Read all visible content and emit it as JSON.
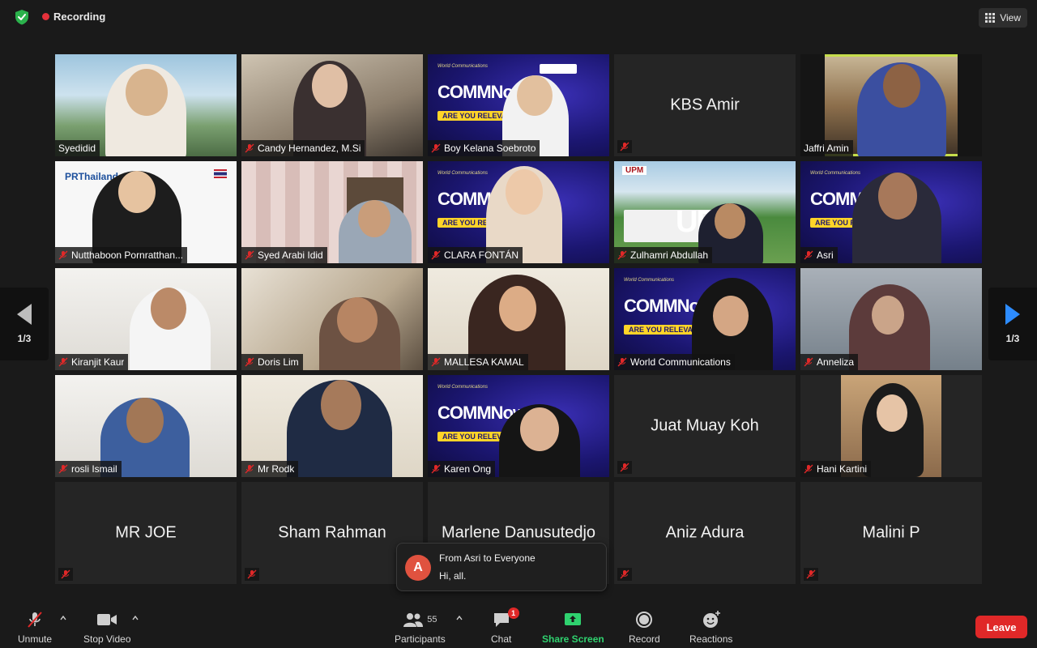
{
  "topbar": {
    "recording_label": "Recording",
    "view_label": "View"
  },
  "participants": [
    {
      "name": "Syedidid",
      "muted": false,
      "type": "video"
    },
    {
      "name": "Candy Hernandez, M.Si",
      "muted": true,
      "type": "video"
    },
    {
      "name": "Boy Kelana Soebroto",
      "muted": true,
      "type": "video"
    },
    {
      "name": "KBS Amir",
      "muted": true,
      "type": "name-only"
    },
    {
      "name": "Jaffri Amin",
      "muted": false,
      "type": "video",
      "active": true
    },
    {
      "name": "Nutthaboon Pornratthan...",
      "muted": true,
      "type": "video"
    },
    {
      "name": "Syed Arabi Idid",
      "muted": true,
      "type": "video"
    },
    {
      "name": "CLARA FONTÁN",
      "muted": true,
      "type": "video"
    },
    {
      "name": "Zulhamri Abdullah",
      "muted": true,
      "type": "video"
    },
    {
      "name": "Asri",
      "muted": true,
      "type": "video"
    },
    {
      "name": "Kiranjit Kaur",
      "muted": true,
      "type": "video"
    },
    {
      "name": "Doris Lim",
      "muted": true,
      "type": "video"
    },
    {
      "name": "MALLESA KAMAL",
      "muted": true,
      "type": "video"
    },
    {
      "name": "World Communications",
      "muted": true,
      "type": "video"
    },
    {
      "name": "Anneliza",
      "muted": true,
      "type": "video"
    },
    {
      "name": "rosli Ismail",
      "muted": true,
      "type": "video"
    },
    {
      "name": "Mr Rodk",
      "muted": true,
      "type": "video"
    },
    {
      "name": "Karen Ong",
      "muted": true,
      "type": "video"
    },
    {
      "name": "Juat Muay Koh",
      "muted": true,
      "type": "name-only"
    },
    {
      "name": "Hani Kartini",
      "muted": true,
      "type": "video"
    },
    {
      "name": "MR JOE",
      "muted": true,
      "type": "name-only"
    },
    {
      "name": "Sham Rahman",
      "muted": true,
      "type": "name-only"
    },
    {
      "name": "Marlene Danusutedjo",
      "muted": true,
      "type": "name-only"
    },
    {
      "name": "Aniz Adura",
      "muted": true,
      "type": "name-only"
    },
    {
      "name": "Malini P",
      "muted": true,
      "type": "name-only"
    }
  ],
  "banner": {
    "comm": "COMMNow",
    "small": "World Communications",
    "relevant": "ARE YOU RELEVANT?"
  },
  "pr_thai": {
    "text": "PRThailand"
  },
  "upm": {
    "logo": "UPM",
    "sign": "UPM"
  },
  "pagination": {
    "left": "1/3",
    "right": "1/3"
  },
  "chat_toast": {
    "avatar_letter": "A",
    "from": "From Asri to Everyone",
    "message": "Hi, all."
  },
  "toolbar": {
    "unmute": "Unmute",
    "stop_video": "Stop Video",
    "participants": "Participants",
    "participants_count": "55",
    "chat": "Chat",
    "chat_badge": "1",
    "share_screen": "Share Screen",
    "record": "Record",
    "reactions": "Reactions",
    "leave": "Leave"
  },
  "colors": {
    "active_speaker": "#c6dd4c",
    "share_green": "#2fd26f",
    "leave_red": "#e02828",
    "nav_blue": "#2d8cff",
    "recording_red": "#e5313b"
  }
}
